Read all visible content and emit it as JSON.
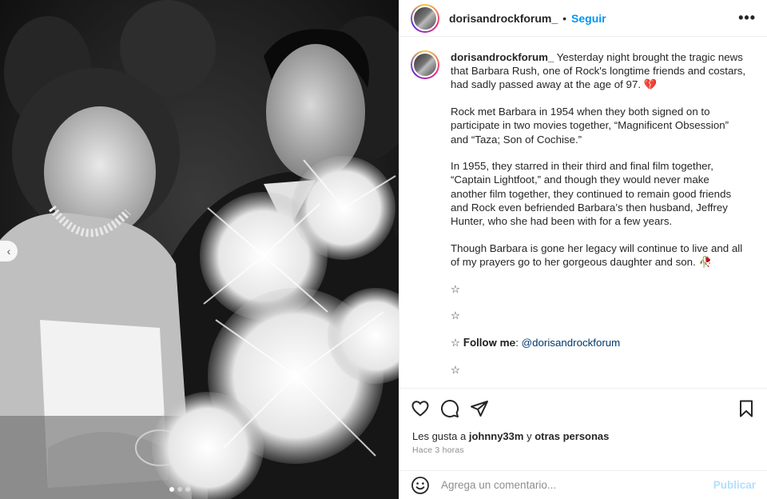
{
  "post": {
    "username": "dorisandrockforum_",
    "separator": "•",
    "follow_label": "Seguir",
    "more_label": "•••"
  },
  "caption": {
    "username": "dorisandrockforum_",
    "para1": " Yesterday night brought the tragic news that Barbara Rush, one of Rock's longtime friends and costars, had sadly passed away at the age of 97. ",
    "para1_emoji": "💔",
    "para2": "Rock met Barbara in 1954 when they both signed on to participate in two movies together, “Magnificent Obsession” and “Taza; Son of Cochise.”",
    "para3": "In 1955, they starred in their third and final film together, “Captain Lightfoot,” and though they would never make another film together, they continued to remain good friends and Rock even befriended Barbara’s then husband, Jeffrey Hunter, who she had been with for a few years.",
    "para4": "Though Barbara is gone her legacy will continue to live and all of my prayers go to her gorgeous daughter and son. ",
    "para4_emoji": "🥀",
    "star": "☆",
    "follow_prefix": "☆ 𝐅𝐨𝐥𝐥𝐨𝐰 𝐦𝐞: ",
    "follow_handle": "@dorisandrockforum"
  },
  "actions": {
    "icons": [
      "heart-icon",
      "comment-icon",
      "share-icon",
      "bookmark-icon"
    ]
  },
  "likes": {
    "prefix": "Les gusta a ",
    "user": "johnny33m",
    "suffix": " y ",
    "others": "otras personas"
  },
  "time_ago": "Hace 3 horas",
  "comment": {
    "placeholder": "Agrega un comentario...",
    "publish_label": "Publicar"
  },
  "photo": {
    "carousel_dots": 3,
    "active_dot": 0,
    "prev_icon": "‹"
  },
  "colors": {
    "follow_blue": "#0095f6",
    "publish_disabled": "#b2dffc",
    "meta_gray": "#8e8e8e"
  }
}
